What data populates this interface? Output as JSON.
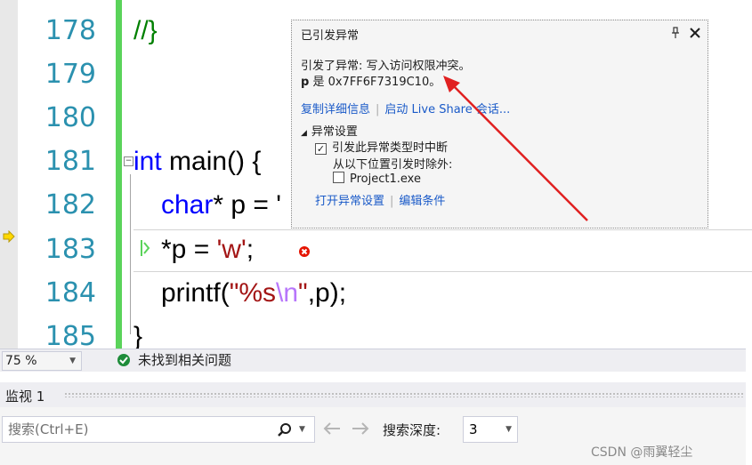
{
  "editor": {
    "line_numbers": [
      "178",
      "179",
      "180",
      "181",
      "182",
      "183",
      "184",
      "185"
    ],
    "lines": {
      "l178": "//}",
      "l181_kw": "int",
      "l181_rest": " main() {",
      "l182_kw": "char",
      "l182_rest": "* p = '",
      "l183_code": "*p = ",
      "l183_str": "'w'",
      "l183_end": ";",
      "l184_a": "printf(",
      "l184_str1": "\"%s",
      "l184_esc": "\\n",
      "l184_str2": "\"",
      "l184_b": ",p);",
      "l185": "}"
    }
  },
  "popup": {
    "title": "已引发异常",
    "pin_icon": "pin-icon",
    "close_icon": "close-icon",
    "message": "引发了异常: 写入访问权限冲突。",
    "detail_var": "p",
    "detail_text": " 是 0x7FF6F7319C10。",
    "link_copy": "复制详细信息",
    "link_liveshare": "启动 Live Share 会话...",
    "section": "异常设置",
    "checkbox_break": "引发此异常类型时中断",
    "except_label": "从以下位置引发时除外:",
    "checkbox_project": "Project1.exe",
    "link_open": "打开异常设置",
    "link_edit": "编辑条件"
  },
  "status": {
    "zoom": "75 %",
    "issues": "未找到相关问题"
  },
  "watch": {
    "title": "监视 1",
    "search_placeholder": "搜索(Ctrl+E)",
    "depth_label": "搜索深度:",
    "depth_value": "3"
  },
  "watermark": "CSDN @雨翼轻尘",
  "colors": {
    "line_number": "#2b91af",
    "keyword": "#0000ff",
    "string": "#a31515",
    "escape": "#b776fb",
    "change_bar": "#5ad35a",
    "link": "#1a5ac8",
    "arrow": "#e02020"
  }
}
